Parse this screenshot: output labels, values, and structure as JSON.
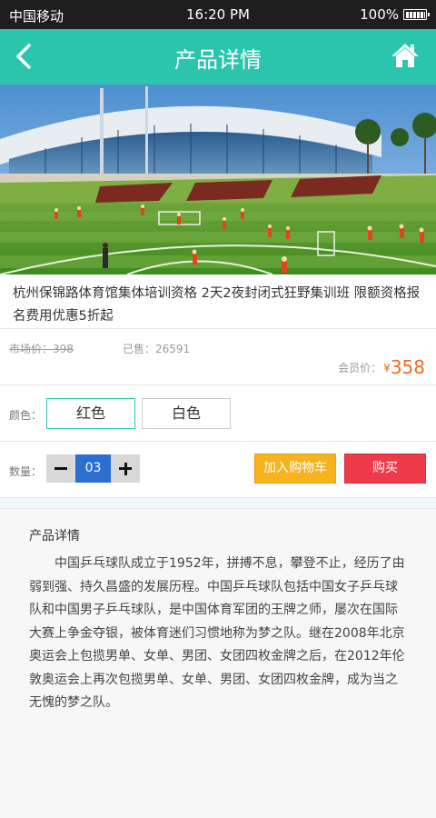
{
  "status_bar": {
    "carrier": "中国移动",
    "time": "16:20 PM",
    "battery": "100%"
  },
  "nav": {
    "title": "产品详情",
    "back_icon": "chevron-left-icon",
    "home_icon": "home-icon"
  },
  "product": {
    "title": "杭州保锦路体育馆集体培训资格  2天2夜封闭式狂野集训班  限额资格报名费用优惠5折起",
    "market_price": "市场价：398",
    "sold": "已售：26591",
    "member_price_label": "会员价：",
    "currency": "¥",
    "member_price": "358"
  },
  "color": {
    "label": "颜色：",
    "options": [
      "红色",
      "白色"
    ],
    "selected": "红色"
  },
  "quantity": {
    "label": "数量：",
    "value": "03"
  },
  "actions": {
    "add_to_cart": "加入购物车",
    "buy": "购买"
  },
  "details": {
    "heading": "产品详情",
    "body": "中国乒乓球队成立于1952年，拼搏不息，攀登不止，经历了由弱到强、持久昌盛的发展历程。中国乒乓球队包括中国女子乒乓球队和中国男子乒乓球队，是中国体育军团的王牌之师，屡次在国际大赛上争金夺银，被体育迷们习惯地称为梦之队。继在2008年北京奥运会上包揽男单、女单、男团、女团四枚金牌之后，在2012年伦敦奥运会上再次包揽男单、女单、男团、女团四枚金牌，成为当之无愧的梦之队。"
  },
  "colors": {
    "accent": "#2bc5ad",
    "price": "#f5691c",
    "cart_button": "#f7b21e",
    "buy_button": "#ee3b4c",
    "qty_value_bg": "#2b6fd1"
  }
}
